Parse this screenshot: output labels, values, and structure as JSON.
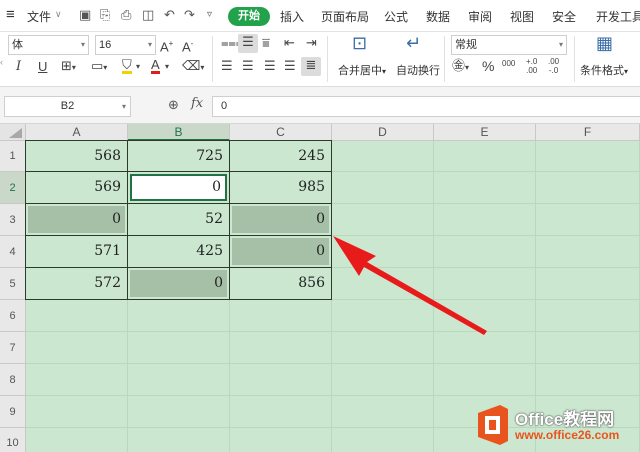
{
  "menubar": {
    "file_label": "文件",
    "tabs": [
      {
        "label": "开始",
        "active": true
      },
      {
        "label": "插入"
      },
      {
        "label": "页面布局"
      },
      {
        "label": "公式"
      },
      {
        "label": "数据"
      },
      {
        "label": "审阅"
      },
      {
        "label": "视图"
      },
      {
        "label": "安全"
      },
      {
        "label": "开发工具"
      }
    ]
  },
  "ribbon": {
    "font_name": "体",
    "font_size": "16",
    "merge_label": "合并居中",
    "wrap_label": "自动换行",
    "number_format": "常规",
    "cond_format_label": "条件格式",
    "percent_glyph": "%",
    "thousand_glyph": "000",
    "dec_inc_glyph": "+.0\n.00",
    "dec_dec_glyph": ".00\n-.0"
  },
  "formula_bar": {
    "name_box": "B2",
    "fx_label": "fx",
    "value": "0"
  },
  "sheet": {
    "columns": [
      "A",
      "B",
      "C",
      "D",
      "E",
      "F"
    ],
    "rows": [
      "1",
      "2",
      "3",
      "4",
      "5",
      "6",
      "7",
      "8",
      "9",
      "10"
    ],
    "cells": [
      [
        "568",
        "725",
        "245"
      ],
      [
        "569",
        "0",
        "985"
      ],
      [
        "0",
        "52",
        "0"
      ],
      [
        "571",
        "425",
        "0"
      ],
      [
        "572",
        "0",
        "856"
      ]
    ],
    "active_cell": "B2"
  },
  "annotation": {
    "color": "#e81b1b"
  },
  "watermark": {
    "brand": "Office教程网",
    "url": "www.office26.com",
    "accent": "#e9541e"
  }
}
